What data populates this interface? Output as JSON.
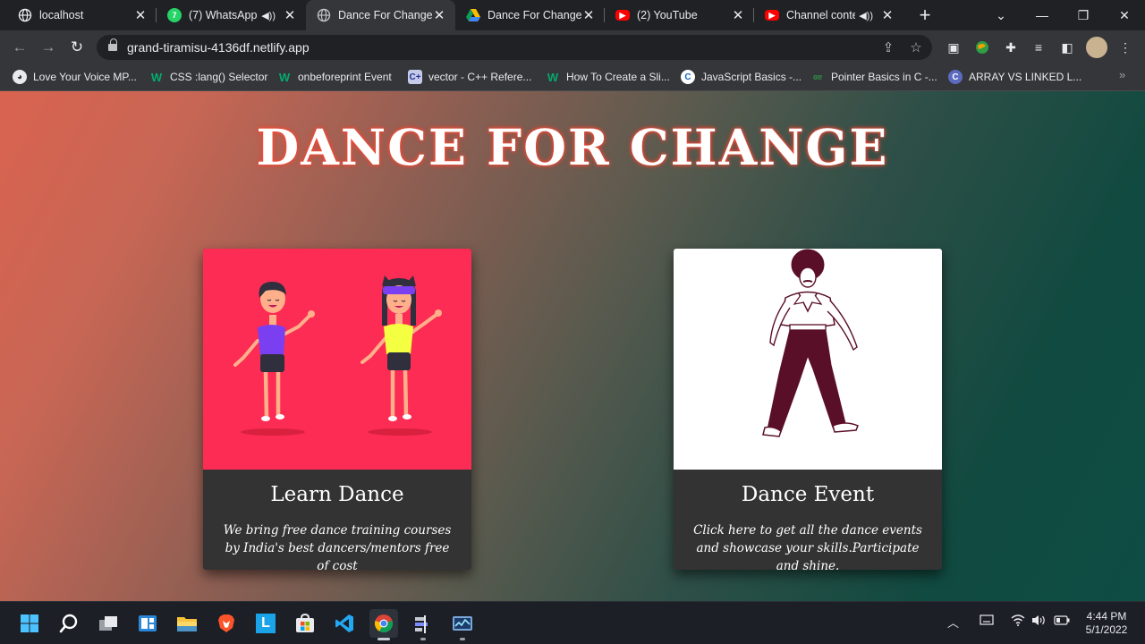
{
  "browser": {
    "tabs": [
      {
        "title": "localhost",
        "icon": "globe-icon",
        "active": false
      },
      {
        "title": "(7) WhatsApp",
        "icon": "whatsapp-icon",
        "active": false,
        "audio": true
      },
      {
        "title": "Dance For Change",
        "icon": "globe-icon",
        "active": true
      },
      {
        "title": "Dance For Change",
        "icon": "google-drive-icon",
        "active": false
      },
      {
        "title": "(2) YouTube",
        "icon": "youtube-icon",
        "active": false
      },
      {
        "title": "Channel conte",
        "icon": "youtube-icon",
        "active": false,
        "audio": true
      }
    ],
    "url": "grand-tiramisu-4136df.netlify.app",
    "bookmarks": [
      {
        "label": "Love Your Voice MP...",
        "icon": "duck-icon"
      },
      {
        "label": "CSS :lang() Selector",
        "icon": "w3schools-icon"
      },
      {
        "label": "onbeforeprint Event",
        "icon": "w3schools-icon"
      },
      {
        "label": "vector - C++ Refere...",
        "icon": "cplusplus-icon"
      },
      {
        "label": "How To Create a Sli...",
        "icon": "w3schools-icon"
      },
      {
        "label": "JavaScript Basics -...",
        "icon": "c-circle-icon"
      },
      {
        "label": "Pointer Basics in C -...",
        "icon": "gfg-icon"
      },
      {
        "label": "ARRAY VS LINKED L...",
        "icon": "c-circle-icon"
      }
    ]
  },
  "page": {
    "title": "DANCE FOR CHANGE",
    "cards": [
      {
        "title": "Learn Dance",
        "description": "We bring free dance training courses by India's best dancers/mentors free of cost",
        "image": "two-dancers-illustration"
      },
      {
        "title": "Dance Event",
        "description": "Click here to get all the dance events and showcase your skills.Participate and shine.",
        "image": "disco-dancer-illustration"
      }
    ]
  },
  "taskbar": {
    "time": "4:44 PM",
    "date": "5/1/2022"
  },
  "colors": {
    "tab_strip": "#202124",
    "toolbar": "#35363a",
    "card_body": "#333333",
    "learn_card_art": "#fc2c55",
    "title_glow": "#ff3b2b"
  }
}
